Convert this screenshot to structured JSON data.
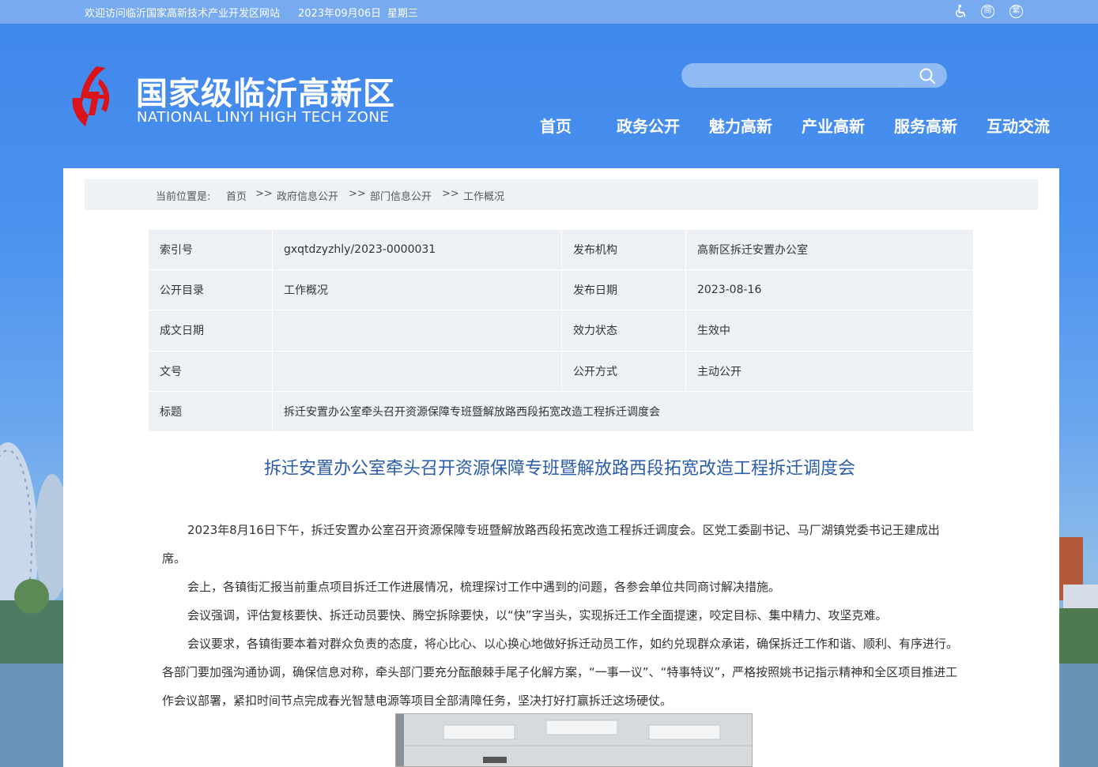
{
  "topbar": {
    "welcome": "欢迎访问临沂国家高新技术产业开发区网站",
    "date": "2023年09月06日",
    "weekday": "星期三",
    "simplified": "简",
    "traditional": "繁"
  },
  "header": {
    "site_name_cn": "国家级临沂高新区",
    "site_name_en": "NATIONAL LINYI HIGH TECH ZONE",
    "search_placeholder": ""
  },
  "nav": [
    "首页",
    "政务公开",
    "魅力高新",
    "产业高新",
    "服务高新",
    "互动交流"
  ],
  "breadcrumb": {
    "prefix": "当前位置是:",
    "items": [
      "首页",
      "政府信息公开",
      "部门信息公开",
      "工作概况"
    ],
    "separator": ">>"
  },
  "meta": {
    "index_label": "索引号",
    "index_value": "gxqtdzyzhly/2023-0000031",
    "org_label": "发布机构",
    "org_value": "高新区拆迁安置办公室",
    "catalog_label": "公开目录",
    "catalog_value": "工作概况",
    "pubdate_label": "发布日期",
    "pubdate_value": "2023-08-16",
    "created_label": "成文日期",
    "created_value": "",
    "status_label": "效力状态",
    "status_value": "生效中",
    "docno_label": "文号",
    "docno_value": "",
    "method_label": "公开方式",
    "method_value": "主动公开",
    "title_label": "标题",
    "title_value": "拆迁安置办公室牵头召开资源保障专班暨解放路西段拓宽改造工程拆迁调度会"
  },
  "article": {
    "title": "拆迁安置办公室牵头召开资源保障专班暨解放路西段拓宽改造工程拆迁调度会",
    "paragraphs": [
      "2023年8月16日下午，拆迁安置办公室召开资源保障专班暨解放路西段拓宽改造工程拆迁调度会。区党工委副书记、马厂湖镇党委书记王建成出席。",
      "会上，各镇街汇报当前重点项目拆迁工作进展情况，梳理探讨工作中遇到的问题，各参会单位共同商讨解决措施。",
      "会议强调，评估复核要快、拆迁动员要快、腾空拆除要快，以“快”字当头，实现拆迁工作全面提速，咬定目标、集中精力、攻坚克难。",
      "会议要求，各镇街要本着对群众负责的态度，将心比心、以心换心地做好拆迁动员工作，如约兑现群众承诺，确保拆迁工作和谐、顺利、有序进行。各部门要加强沟通协调，确保信息对称，牵头部门要充分酝酿棘手尾子化解方案，“一事一议”、“特事特议”，严格按照姚书记指示精神和全区项目推进工作会议部署，紧扣时间节点完成春光智慧电源等项目全部清障任务，坚决打好打赢拆迁这场硬仗。"
    ]
  },
  "colors": {
    "primary_blue": "#3f86ea",
    "title_blue": "#2a5ca8",
    "logo_red": "#d9141b"
  },
  "icons": [
    "accessibility-icon",
    "search-icon",
    "logo-icon"
  ]
}
